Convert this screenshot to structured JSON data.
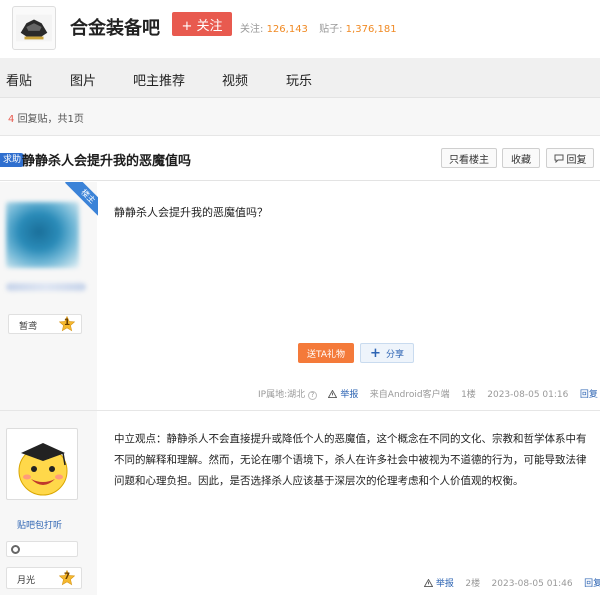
{
  "forum": {
    "name": "合金装备吧",
    "follow_label": "+ 关注",
    "followers_label": "关注:",
    "followers": "126,143",
    "posts_label": "贴子:",
    "posts": "1,376,181"
  },
  "nav": [
    "看贴",
    "图片",
    "吧主推荐",
    "视频",
    "玩乐"
  ],
  "reply_info": {
    "count": "4",
    "text": "回复贴，共1页"
  },
  "thread": {
    "tag": "求助",
    "title": "静静杀人会提升我的恶魔值吗",
    "buttons": {
      "only_op": "只看楼主",
      "favorite": "收藏",
      "reply": "回复"
    }
  },
  "post1": {
    "op_badge": "楼主",
    "level_label": "暂鸢",
    "level_num": "1",
    "content": "静静杀人会提升我的恶魔值吗？",
    "gift_label": "送TA礼物",
    "share_label": "分享",
    "ip": "IP属地:湖北",
    "report": "举报",
    "client": "来自Android客户端",
    "floor": "1楼",
    "time": "2023-08-05 01:16",
    "reply": "回复"
  },
  "post2": {
    "username": "贴吧包打听",
    "level_label": "月光",
    "level_num": "7",
    "content": "中立观点：静静杀人不会直接提升或降低个人的恶魔值，这个概念在不同的文化、宗教和哲学体系中有不同的解释和理解。然而，无论在哪个语境下，杀人在许多社会中被视为不道德的行为，可能导致法律问题和心理负担。因此，是否选择杀人应该基于深层次的伦理考虑和个人价值观的权衡。",
    "report": "举报",
    "floor": "2楼",
    "time": "2023-08-05 01:46",
    "reply": "回复"
  },
  "colors": {
    "accent_red": "#e85a4f",
    "link_blue": "#2d64b3",
    "gift_orange": "#f47a3a",
    "count_orange": "#f08a24"
  },
  "icons": [
    "forum-logo-icon",
    "plus-icon",
    "warning-icon",
    "question-icon",
    "star-level-icon",
    "avatar-cartoon-icon"
  ]
}
